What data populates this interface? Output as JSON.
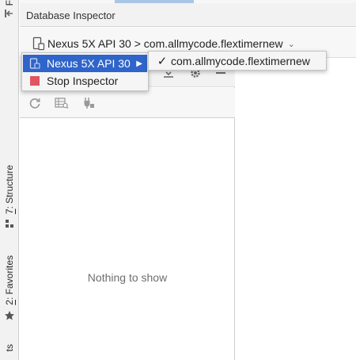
{
  "stripe": {
    "structure_label": "7: Structure",
    "structure_mnemonic": "7",
    "structure_rest": ": Structure",
    "favorites_mnemonic": "2",
    "favorites_rest": ": Favorites",
    "top_partial": "F",
    "bottom_partial": "ts"
  },
  "header": {
    "title": "Database Inspector"
  },
  "selector": {
    "label": "Nexus 5X API 30 > com.allmycode.flextimernew"
  },
  "menu": {
    "device_item": "Nexus 5X API 30",
    "stop_item": "Stop Inspector"
  },
  "submenu": {
    "process_item": "com.allmycode.flextimernew",
    "checked": true
  },
  "panel": {
    "empty_text": "Nothing to show"
  },
  "colors": {
    "menu_selection": "#2f65ca",
    "stop_icon": "#e05561",
    "icon_gray": "#9a9a9a"
  }
}
